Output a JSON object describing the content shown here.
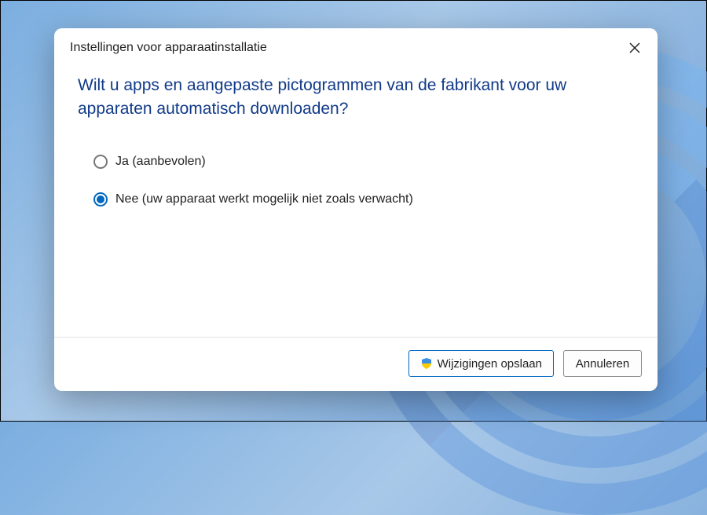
{
  "dialog": {
    "title": "Instellingen voor apparaatinstallatie",
    "heading": "Wilt u apps en aangepaste pictogrammen van de fabrikant voor uw apparaten automatisch downloaden?",
    "options": {
      "yes": {
        "label": "Ja (aanbevolen)",
        "selected": false
      },
      "no": {
        "label": "Nee (uw apparaat werkt mogelijk niet zoals verwacht)",
        "selected": true
      }
    },
    "buttons": {
      "save": "Wijzigingen opslaan",
      "cancel": "Annuleren"
    }
  }
}
